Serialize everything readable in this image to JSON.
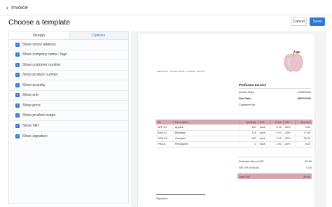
{
  "header": {
    "back_icon": "chevron-left-icon",
    "app_title": "Invoice",
    "page_title": "Choose a template",
    "cancel_label": "Cancel",
    "save_label": "Save",
    "accent_color": "#2b7bd6"
  },
  "left_panel": {
    "tabs": [
      {
        "label": "Design",
        "active": true
      },
      {
        "label": "Options",
        "active": false
      }
    ],
    "options": [
      {
        "label": "Show return address",
        "checked": true
      },
      {
        "label": "Show company name / logo",
        "checked": true
      },
      {
        "label": "Show customer number",
        "checked": true
      },
      {
        "label": "Show product number",
        "checked": true
      },
      {
        "label": "Show quantity",
        "checked": true
      },
      {
        "label": "Show unit",
        "checked": true
      },
      {
        "label": "Show price",
        "checked": true
      },
      {
        "label": "Show product image",
        "checked": true
      },
      {
        "label": "Show VAT",
        "checked": true
      },
      {
        "label": "Show signature",
        "checked": true
      }
    ]
  },
  "invoice": {
    "sender_line": "Rabby Fruits · 11 Green Terrace · LONDON · E14 5TH",
    "title": "Proforma Invoice",
    "invoice_date_label": "Invoice Date",
    "invoice_date": "24/06/2020",
    "due_date_label": "Due Date",
    "due_date": "08/07/2020",
    "customer_no_label": "Customer No.",
    "customer_no": "",
    "table_headers": [
      "No",
      "Description",
      "Quantity",
      "Unit",
      "Price",
      "VAT",
      "Amount"
    ],
    "rows": [
      {
        "no": "APP-01",
        "description": "Apples",
        "quantity": "120",
        "unit": "each",
        "price": "0.12",
        "vat": "20%",
        "amount": "9.60"
      },
      {
        "no": "BAN-01",
        "description": "Bananas",
        "quantity": "178",
        "unit": "each",
        "price": "0.10",
        "vat": "20%",
        "amount": "17.80"
      },
      {
        "no": "ORA-01",
        "description": "Oranges",
        "quantity": "155",
        "unit": "each",
        "price": "0.15",
        "vat": "20%",
        "amount": "23.25"
      },
      {
        "no": "PIN-01",
        "description": "Pineapples",
        "quantity": "2",
        "unit": "each",
        "price": "2.50",
        "vat": "20%",
        "amount": "5.00"
      }
    ],
    "subtotal_label": "Subtotal without VAT",
    "subtotal": "55.60",
    "vat_label": "VAT 0% of 55.60",
    "vat_value": "0.00",
    "total_label": "Total VAT",
    "total_value": "55.60",
    "signature_label": "Signature",
    "table_header_color": "#d7a7ae"
  }
}
